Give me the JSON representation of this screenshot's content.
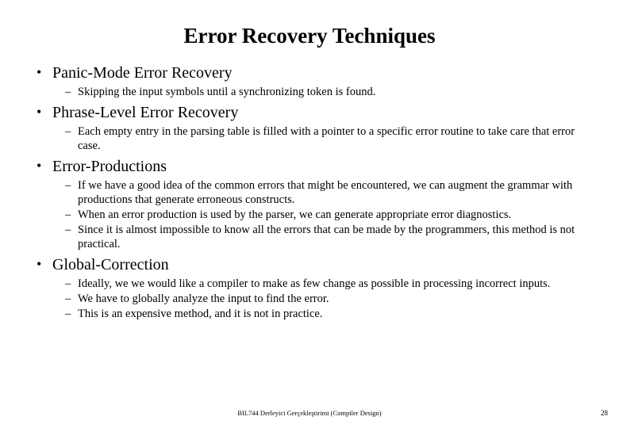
{
  "title": "Error Recovery Techniques",
  "sections": [
    {
      "heading": "Panic-Mode Error Recovery",
      "points": [
        "Skipping the input symbols until a synchronizing token is found."
      ]
    },
    {
      "heading": "Phrase-Level Error Recovery",
      "points": [
        "Each empty entry in the parsing table is filled with a pointer to a specific error routine to take care that error case."
      ]
    },
    {
      "heading": "Error-Productions",
      "points": [
        "If we have a good idea of the common errors that might be encountered, we can augment the grammar with productions that generate erroneous constructs.",
        "When an error production is used by the parser, we can generate appropriate error diagnostics.",
        "Since it is almost impossible to know all the errors that can be made by the programmers, this method is not practical."
      ]
    },
    {
      "heading": "Global-Correction",
      "points": [
        "Ideally, we we would like a compiler to make as few change as possible in processing incorrect inputs.",
        "We have to globally analyze the input to find the error.",
        "This is an expensive method, and it is not in practice."
      ]
    }
  ],
  "footer": "BIL744 Derleyici Gerçekleştirimi (Compiler Design)",
  "page_number": "28"
}
